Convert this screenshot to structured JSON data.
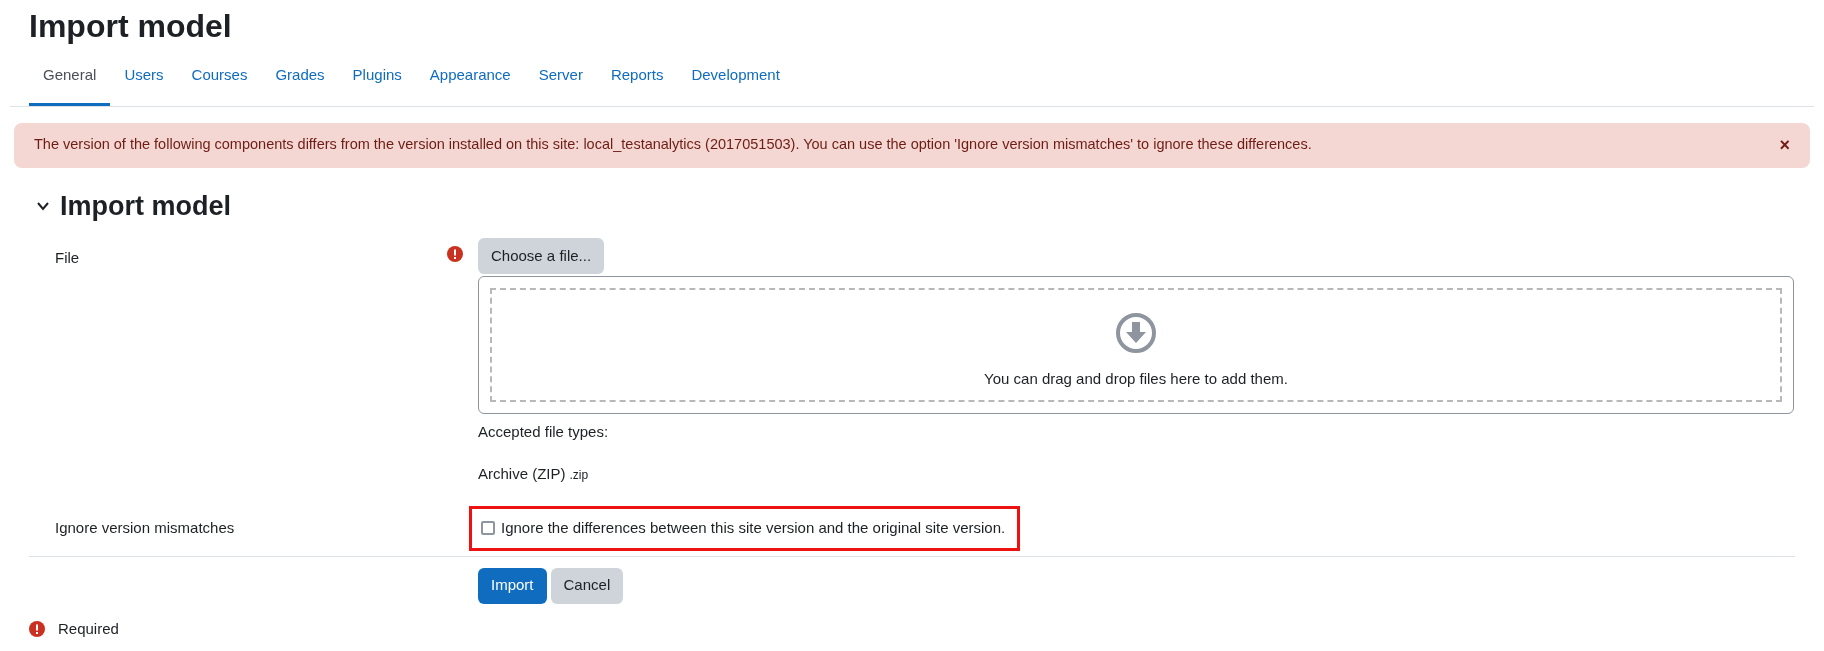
{
  "page_title": "Import model",
  "tabs": [
    {
      "label": "General",
      "selected": true
    },
    {
      "label": "Users",
      "selected": false
    },
    {
      "label": "Courses",
      "selected": false
    },
    {
      "label": "Grades",
      "selected": false
    },
    {
      "label": "Plugins",
      "selected": false
    },
    {
      "label": "Appearance",
      "selected": false
    },
    {
      "label": "Server",
      "selected": false
    },
    {
      "label": "Reports",
      "selected": false
    },
    {
      "label": "Development",
      "selected": false
    }
  ],
  "alert": {
    "message": "The version of the following components differs from the version installed on this site: local_testanalytics (2017051503). You can use the option 'Ignore version mismatches' to ignore these differences.",
    "close": "×"
  },
  "section": {
    "heading": "Import model",
    "expanded": true
  },
  "file_field": {
    "label": "File",
    "required": true,
    "button": "Choose a file...",
    "dropzone_text": "You can drag and drop files here to add them.",
    "accepted_label": "Accepted file types:",
    "accepted_type": "Archive (ZIP)",
    "accepted_ext": ".zip"
  },
  "ignore_field": {
    "label": "Ignore version mismatches",
    "checkbox_label": "Ignore the differences between this site version and the original site version.",
    "checked": false,
    "highlighted": true
  },
  "buttons": [
    {
      "label": "Import",
      "kind": "primary"
    },
    {
      "label": "Cancel",
      "kind": "secondary"
    }
  ],
  "required_note": "Required"
}
